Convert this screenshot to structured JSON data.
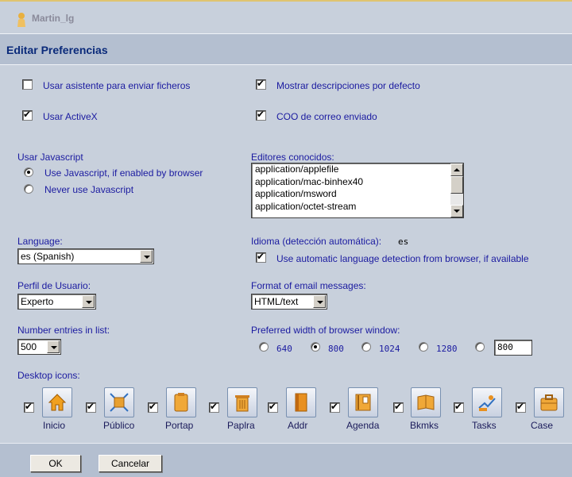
{
  "user": {
    "name": "Martin_lg",
    "icon": "user-icon"
  },
  "section_title": "Editar Preferencias",
  "options_left": [
    {
      "label": "Usar asistente para enviar ficheros",
      "checked": false
    },
    {
      "label": "Usar ActiveX",
      "checked": true
    }
  ],
  "options_right": [
    {
      "label": "Mostrar descripciones por defecto",
      "checked": true
    },
    {
      "label": "COO de correo enviado",
      "checked": true
    }
  ],
  "javascript": {
    "title": "Usar Javascript",
    "options": [
      {
        "label": "Use Javascript, if enabled by browser",
        "selected": true
      },
      {
        "label": "Never use Javascript",
        "selected": false
      }
    ]
  },
  "editors": {
    "title": "Editores conocidos:",
    "items": [
      "application/applefile",
      "application/mac-binhex40",
      "application/msword",
      "application/octet-stream"
    ]
  },
  "language": {
    "label": "Language:",
    "value": "es (Spanish)"
  },
  "idioma": {
    "label": "Idioma (detección automática):",
    "value": "es",
    "auto_label": "Use automatic language detection from browser, if available",
    "auto_checked": true
  },
  "perfil": {
    "label": "Perfil de Usuario:",
    "value": "Experto"
  },
  "email_format": {
    "label": "Format of email messages:",
    "value": "HTML/text"
  },
  "entries": {
    "label": "Number entries in list:",
    "value": "500"
  },
  "browser_width": {
    "label": "Preferred width of browser window:",
    "options": [
      "640",
      "800",
      "1024",
      "1280"
    ],
    "selected": "800",
    "custom_value": "800"
  },
  "desktop": {
    "title": "Desktop icons:",
    "icons": [
      {
        "label": "Inicio",
        "icon": "home-icon",
        "checked": true
      },
      {
        "label": "Público",
        "icon": "public-icon",
        "checked": true
      },
      {
        "label": "Portap",
        "icon": "clipboard-icon",
        "checked": true
      },
      {
        "label": "Paplra",
        "icon": "trash-icon",
        "checked": true
      },
      {
        "label": "Addr",
        "icon": "address-book-icon",
        "checked": true
      },
      {
        "label": "Agenda",
        "icon": "agenda-icon",
        "checked": true
      },
      {
        "label": "Bkmks",
        "icon": "bookmarks-icon",
        "checked": true
      },
      {
        "label": "Tasks",
        "icon": "tasks-icon",
        "checked": true
      },
      {
        "label": "Case",
        "icon": "briefcase-icon",
        "checked": true
      }
    ]
  },
  "buttons": {
    "ok": "OK",
    "cancel": "Cancelar"
  },
  "colors": {
    "label_text": "#1a1aa0",
    "background": "#c8d0dc",
    "header_bar": "#b4bfd0",
    "title": "#0a2a7a"
  }
}
